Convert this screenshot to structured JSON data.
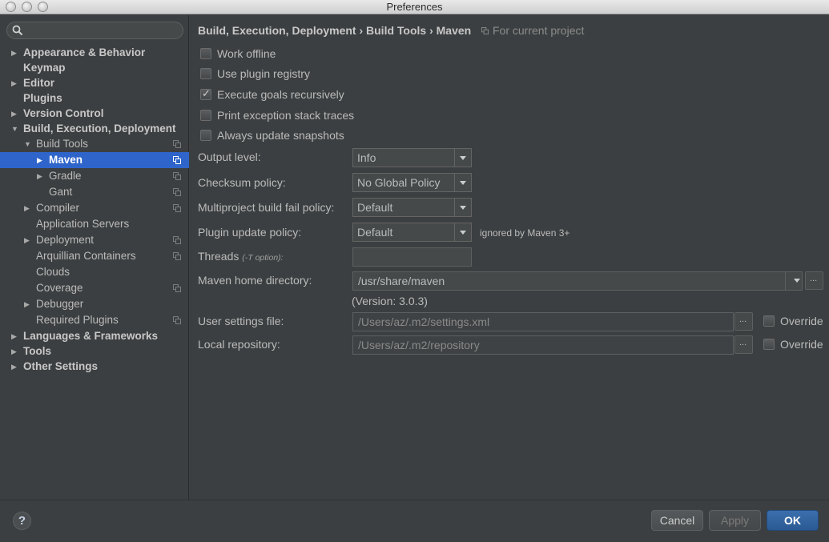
{
  "window": {
    "title": "Preferences"
  },
  "sidebar": {
    "search_placeholder": "",
    "items": [
      {
        "label": "Appearance & Behavior"
      },
      {
        "label": "Keymap"
      },
      {
        "label": "Editor"
      },
      {
        "label": "Plugins"
      },
      {
        "label": "Version Control"
      },
      {
        "label": "Build, Execution, Deployment"
      },
      {
        "label": "Build Tools"
      },
      {
        "label": "Maven"
      },
      {
        "label": "Gradle"
      },
      {
        "label": "Gant"
      },
      {
        "label": "Compiler"
      },
      {
        "label": "Application Servers"
      },
      {
        "label": "Deployment"
      },
      {
        "label": "Arquillian Containers"
      },
      {
        "label": "Clouds"
      },
      {
        "label": "Coverage"
      },
      {
        "label": "Debugger"
      },
      {
        "label": "Required Plugins"
      },
      {
        "label": "Languages & Frameworks"
      },
      {
        "label": "Tools"
      },
      {
        "label": "Other Settings"
      }
    ]
  },
  "header": {
    "breadcrumb": "Build, Execution, Deployment › Build Tools › Maven",
    "scope_note": "For current project"
  },
  "options": {
    "work_offline": {
      "label": "Work offline",
      "checked": false
    },
    "use_plugin_registry": {
      "label": "Use plugin registry",
      "checked": false
    },
    "execute_goals_recursively": {
      "label": "Execute goals recursively",
      "checked": true
    },
    "print_exception_stack_traces": {
      "label": "Print exception stack traces",
      "checked": false
    },
    "always_update_snapshots": {
      "label": "Always update snapshots",
      "checked": false
    }
  },
  "form": {
    "output_level": {
      "label": "Output level:",
      "value": "Info"
    },
    "checksum_policy": {
      "label": "Checksum policy:",
      "value": "No Global Policy"
    },
    "multiproject_fail_policy": {
      "label": "Multiproject build fail policy:",
      "value": "Default"
    },
    "plugin_update_policy": {
      "label": "Plugin update policy:",
      "value": "Default",
      "hint": "ignored by Maven 3+"
    },
    "threads": {
      "label": "Threads",
      "label_note": "(-T option):",
      "value": ""
    },
    "maven_home": {
      "label": "Maven home directory:",
      "value": "/usr/share/maven",
      "version": "(Version: 3.0.3)"
    },
    "user_settings": {
      "label": "User settings file:",
      "value": "/Users/az/.m2/settings.xml",
      "override": "Override"
    },
    "local_repository": {
      "label": "Local repository:",
      "value": "/Users/az/.m2/repository",
      "override": "Override"
    }
  },
  "buttons": {
    "help": "?",
    "cancel": "Cancel",
    "apply": "Apply",
    "ok": "OK"
  },
  "colors": {
    "background": "#3c3f41",
    "selection": "#2f65ca",
    "primary_button": "#2b5a93"
  }
}
